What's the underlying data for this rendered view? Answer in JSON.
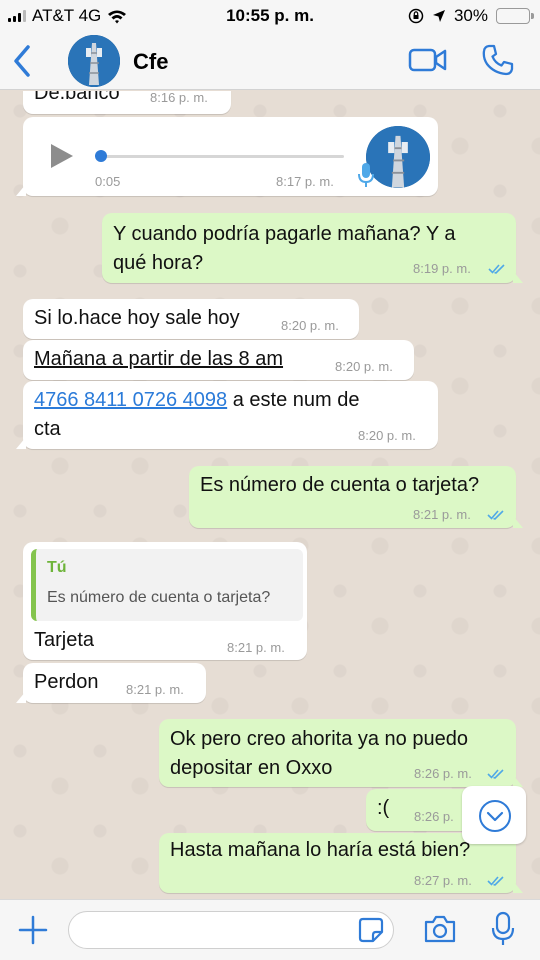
{
  "status_bar": {
    "carrier": "AT&T 4G",
    "time": "10:55 p. m.",
    "battery": "30%",
    "battery_level": 0.3
  },
  "header": {
    "contact_name": "Cfe",
    "icons": [
      "back-chevron-icon",
      "video-call-icon",
      "phone-icon"
    ]
  },
  "messages": [
    {
      "type": "text",
      "direction": "in",
      "text": "De.banco",
      "time": "8:16 p. m."
    },
    {
      "type": "voice",
      "direction": "in",
      "duration": "0:05",
      "time": "8:17 p. m."
    },
    {
      "type": "text",
      "direction": "out",
      "text": "Y cuando podría pagarle mañana? Y a\nqué hora?",
      "time": "8:19 p. m."
    },
    {
      "type": "text",
      "direction": "in",
      "text": "Si lo.hace hoy sale hoy",
      "time": "8:20 p. m."
    },
    {
      "type": "text",
      "direction": "in",
      "text": "Mañana a partir de las 8 am",
      "time": "8:20 p. m."
    },
    {
      "type": "text",
      "direction": "in",
      "link": "4766 8411 0726 4098",
      "text": " a este num de\ncta",
      "time": "8:20 p. m."
    },
    {
      "type": "text",
      "direction": "out",
      "text": "Es número de cuenta o tarjeta?",
      "time": "8:21 p. m."
    },
    {
      "type": "reply",
      "direction": "in",
      "quote_author": "Tú",
      "quote_text": "Es número de cuenta o tarjeta?",
      "text": "Tarjeta",
      "time": "8:21 p. m."
    },
    {
      "type": "text",
      "direction": "in",
      "text": "Perdon",
      "time": "8:21 p. m."
    },
    {
      "type": "text",
      "direction": "out",
      "text": "Ok pero creo ahorita ya no puedo\ndepositar en Oxxo",
      "time": "8:26 p. m."
    },
    {
      "type": "text",
      "direction": "out",
      "text": ":(",
      "time": "8:26 p."
    },
    {
      "type": "text",
      "direction": "out",
      "text": "Hasta mañana lo haría está bien?",
      "time": "8:27 p. m."
    }
  ],
  "input": {
    "placeholder": ""
  },
  "colors": {
    "accent": "#2f7bd7",
    "outgoing_bubble": "#dcf8c6",
    "incoming_bubble": "#ffffff",
    "read_check": "#4fa8e8",
    "chat_bg": "#e6ddd4"
  }
}
